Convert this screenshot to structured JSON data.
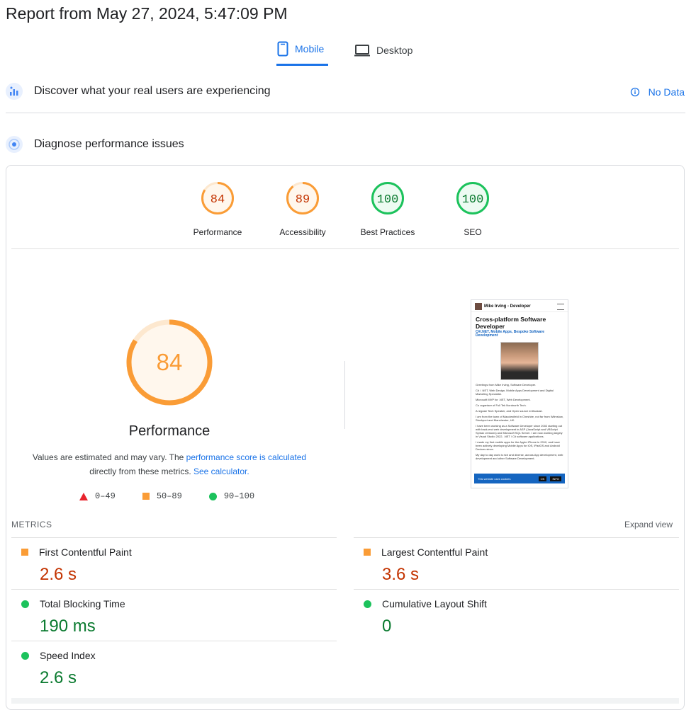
{
  "report": {
    "title": "Report from May 27, 2024, 5:47:09 PM"
  },
  "tabs": [
    {
      "label": "Mobile",
      "icon": "phone-icon",
      "active": true
    },
    {
      "label": "Desktop",
      "icon": "laptop-icon",
      "active": false
    }
  ],
  "field_data": {
    "label": "Discover what your real users are experiencing",
    "status": "No Data"
  },
  "diagnose": {
    "label": "Diagnose performance issues"
  },
  "categories": [
    {
      "label": "Performance",
      "score": "84",
      "rating": "average"
    },
    {
      "label": "Accessibility",
      "score": "89",
      "rating": "average"
    },
    {
      "label": "Best Practices",
      "score": "100",
      "rating": "pass"
    },
    {
      "label": "SEO",
      "score": "100",
      "rating": "pass"
    }
  ],
  "performance": {
    "score": "84",
    "score_fraction": 0.84,
    "title": "Performance",
    "desc_1": "Values are estimated and may vary. The ",
    "desc_link_1": "performance score is calculated",
    "desc_2": " directly from these metrics. ",
    "desc_link_2": "See calculator."
  },
  "legend": [
    {
      "shape": "triangle",
      "range": "0–49",
      "color": "#e8232d"
    },
    {
      "shape": "square",
      "range": "50–89",
      "color": "#fa9c36"
    },
    {
      "shape": "circle",
      "range": "90–100",
      "color": "#1cc25c"
    }
  ],
  "screenshot": {
    "site_name": "Mike Irving - Developer",
    "heading": "Cross-platform Software Developer",
    "subheading": "C#/.NET, Mobile Apps, Bespoke Software Development",
    "paragraphs": [
      "Greetings from Mike Irving, Software Developer.",
      "C# / .NET, Web Design, Mobile Apps Development and Digital Marketing Specialist.",
      "Microsoft MVP for .NET, Web Development.",
      "Co organiser of Full Tek Nordnorth Tech.",
      "A regular Tech Speaker, and Open source enthusiast.",
      "I am from the town of Macclesfield in Cheshire, not far from Wilmslow, Stockport and Manchester, UK.",
      "I have been working as a Software Developer since 2002 starting out with back-end web development in ASP (JavaScript and VBScript Syntax versions) and Microsoft SQL Server. I am now working largely in Visual Studio 2022, .NET / C# software applications.",
      "I made my first mobile apps for the Apple iPhone in 2010, and have been actively developing Mobile Apps for iOS, iPadOS and Android Devices since.",
      "My day to day work is rich and diverse, across App development, web development and other Software Development."
    ],
    "cookie_text": "This website uses cookies",
    "cookie_ok": "OK",
    "cookie_info": "INFO"
  },
  "metrics": {
    "header": "METRICS",
    "expand_label": "Expand view",
    "items": [
      {
        "name": "First Contentful Paint",
        "value": "2.6 s",
        "rating": "average"
      },
      {
        "name": "Largest Contentful Paint",
        "value": "3.6 s",
        "rating": "average"
      },
      {
        "name": "Total Blocking Time",
        "value": "190 ms",
        "rating": "pass"
      },
      {
        "name": "Cumulative Layout Shift",
        "value": "0",
        "rating": "pass"
      },
      {
        "name": "Speed Index",
        "value": "2.6 s",
        "rating": "pass"
      }
    ]
  },
  "colors": {
    "accent": "#1a73e8",
    "average": "#fa9c36",
    "average_text": "#c33300",
    "pass": "#1cc25c",
    "pass_text": "#0a7a2f",
    "fail": "#e8232d"
  }
}
